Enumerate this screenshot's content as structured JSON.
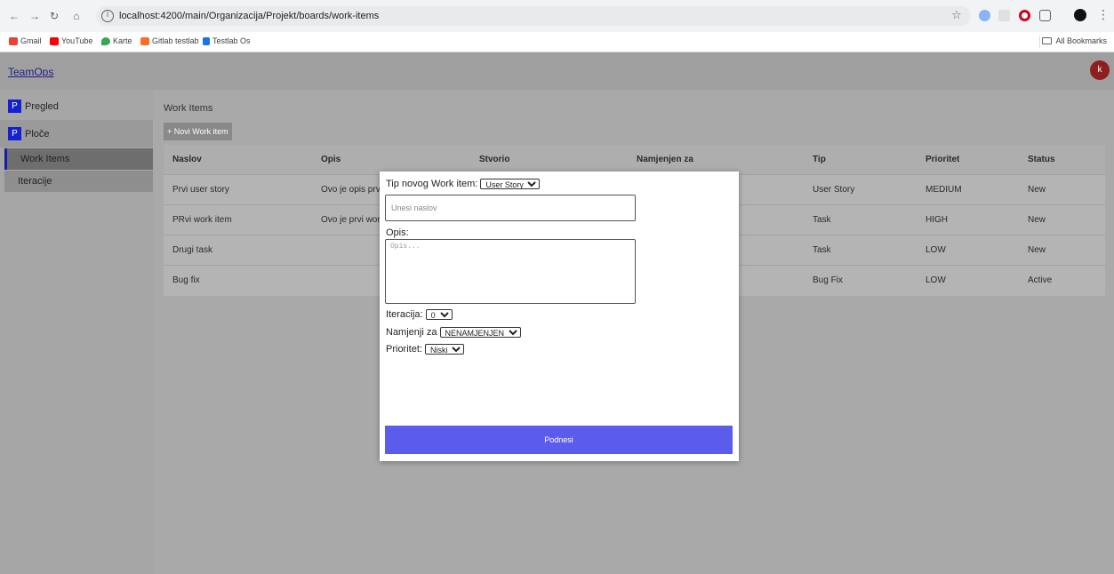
{
  "browser": {
    "url": "localhost:4200/main/Organizacija/Projekt/boards/work-items",
    "bookmarks": [
      "Gmail",
      "YouTube",
      "Karte",
      "Gitlab testlab",
      "Testlab Os"
    ],
    "all_bookmarks": "All Bookmarks"
  },
  "app": {
    "brand": "TeamOps",
    "avatar_initial": "k"
  },
  "sidebar": {
    "items": [
      {
        "badge": "P",
        "label": "Pregled"
      },
      {
        "badge": "P",
        "label": "Ploče"
      }
    ],
    "subitems": [
      "Work Items",
      "Iteracije"
    ]
  },
  "main": {
    "title": "Work Items",
    "new_button": "+ Novi Work item",
    "columns": [
      "Naslov",
      "Opis",
      "Stvorio",
      "Namjenjen za",
      "Tip",
      "Prioritet",
      "Status"
    ],
    "rows": [
      [
        "Prvi user story",
        "Ovo je opis prv...",
        "",
        "",
        "User Story",
        "MEDIUM",
        "New"
      ],
      [
        "PRvi work item",
        "Ovo je prvi wor...",
        "",
        "",
        "Task",
        "HIGH",
        "New"
      ],
      [
        "Drugi task",
        "",
        "",
        "",
        "Task",
        "LOW",
        "New"
      ],
      [
        "Bug fix",
        "",
        "",
        "",
        "Bug Fix",
        "LOW",
        "Active"
      ]
    ]
  },
  "modal": {
    "type_label": "Tip novog Work item:",
    "type_value": "User Story",
    "title_placeholder": "Unesi naslov",
    "desc_label": "Opis:",
    "desc_placeholder": "Opis...",
    "iteration_label": "Iteracija:",
    "iteration_value": "0",
    "assign_label": "Namjenji za",
    "assign_value": "NENAMJENJEN",
    "priority_label": "Prioritet:",
    "priority_value": "Niski",
    "submit_label": "Podnesi"
  },
  "colors": {
    "accent": "#5b5bec",
    "badge": "#1520d6",
    "avatar": "#8f1e1e",
    "overlay": "#a9a9a9"
  }
}
